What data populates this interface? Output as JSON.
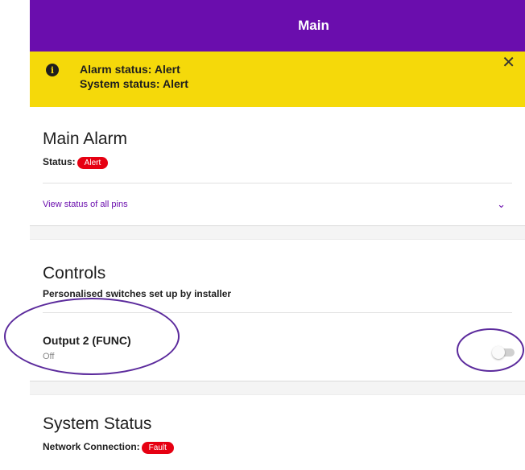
{
  "header": {
    "title": "Main"
  },
  "banner": {
    "icon": "info-icon",
    "alarm_status": "Alarm status: Alert",
    "system_status": "System status: Alert",
    "close_symbol": "✕"
  },
  "main_alarm": {
    "title": "Main Alarm",
    "status_label": "Status:",
    "status_badge": "Alert",
    "pins_link": "View status of all pins",
    "chevron": "⌄"
  },
  "controls": {
    "title": "Controls",
    "subtitle": "Personalised switches set up by installer",
    "output": {
      "name": "Output 2 (FUNC)",
      "state": "Off",
      "on": false
    }
  },
  "system_status": {
    "title": "System Status",
    "network_label": "Network Connection:",
    "network_badge": "Fault"
  },
  "colors": {
    "brand_purple": "#6a0dad",
    "banner_yellow": "#f5d90a",
    "badge_red": "#e60012",
    "annotation": "#5b2a9c"
  }
}
